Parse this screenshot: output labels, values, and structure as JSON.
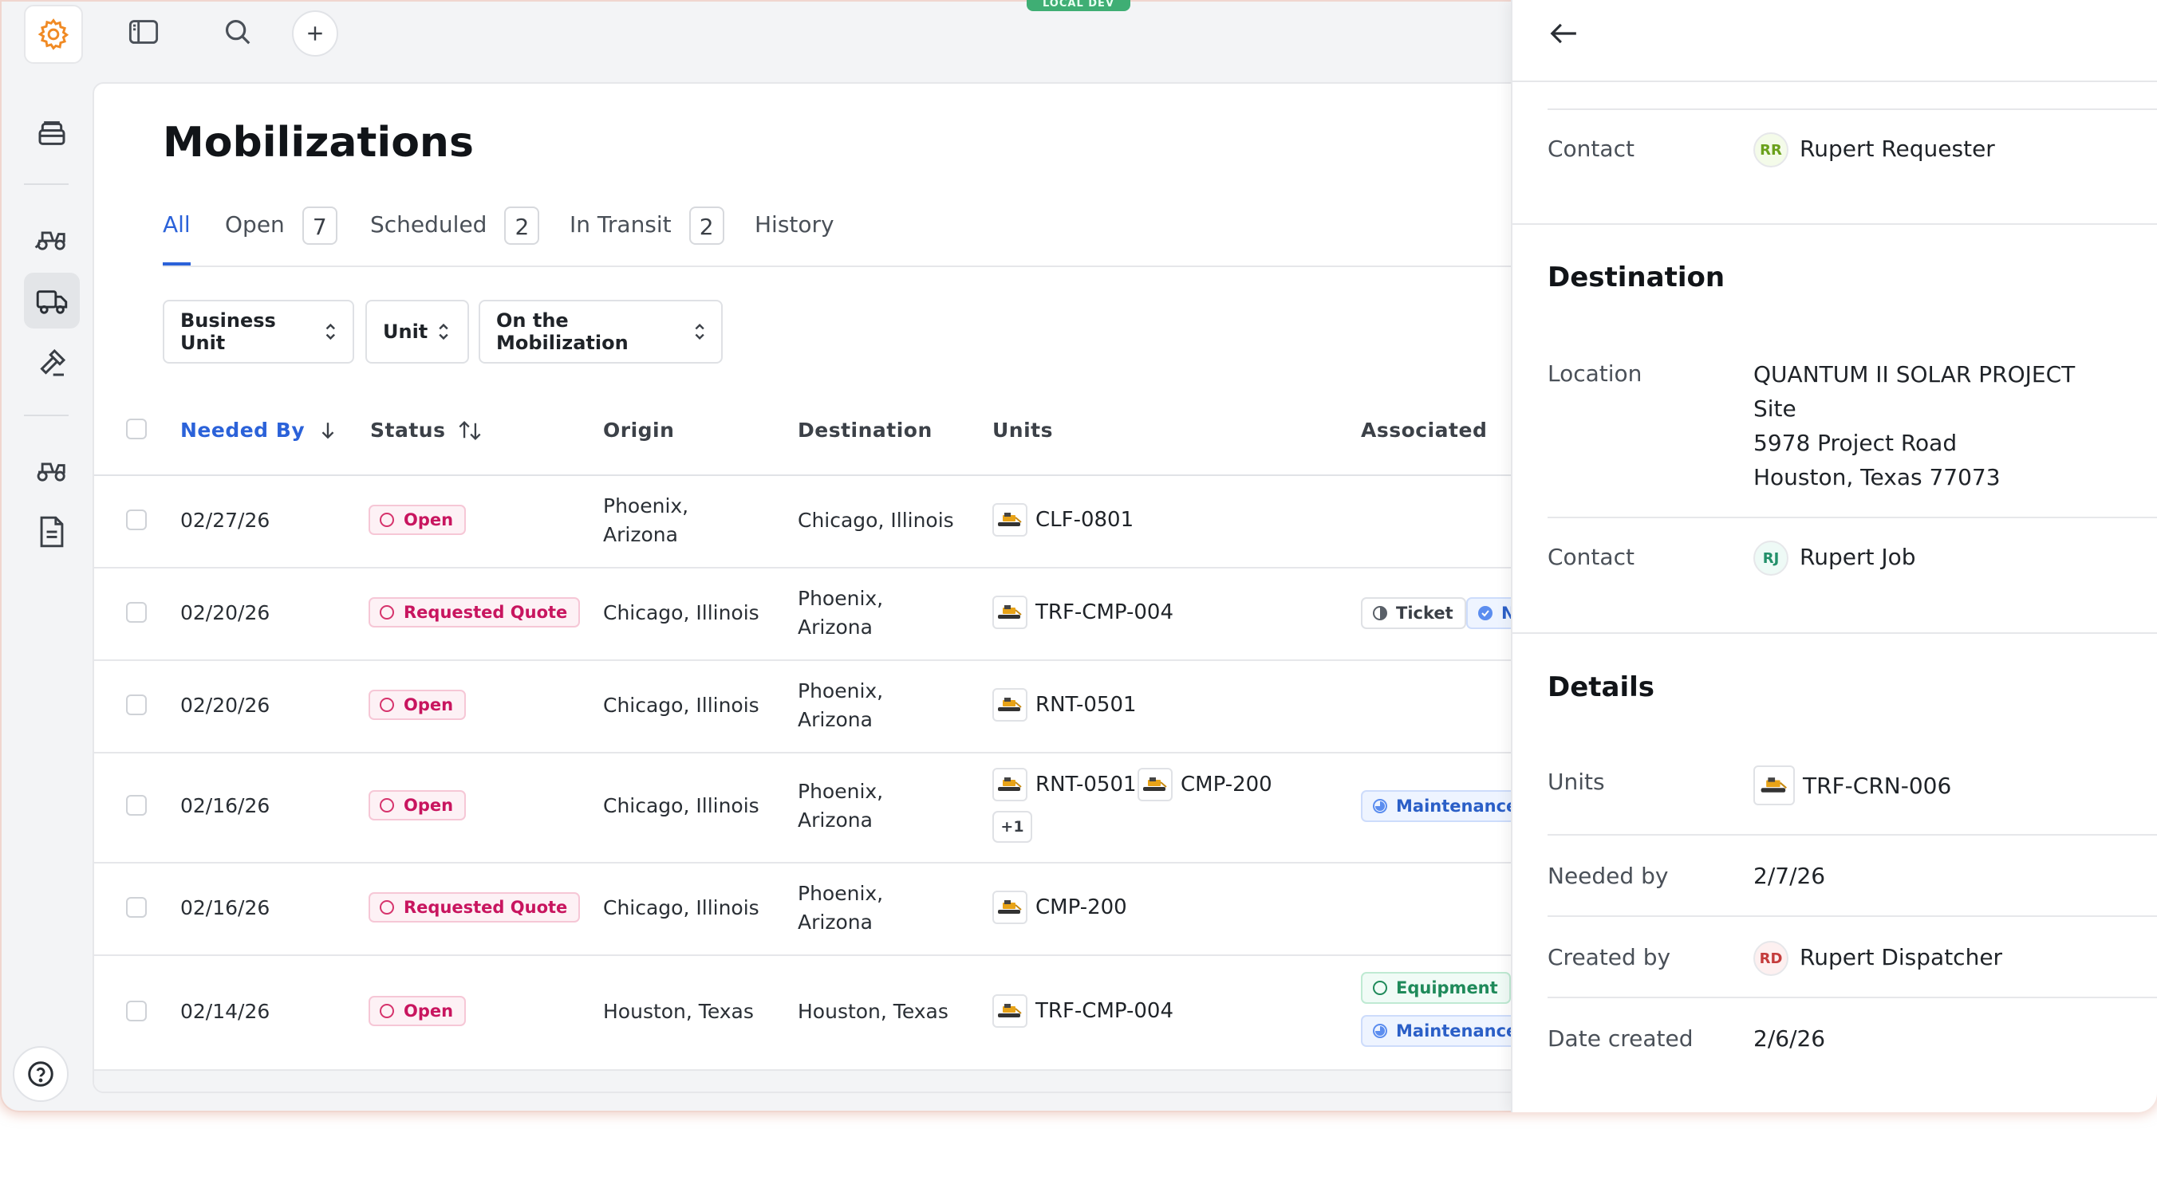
{
  "dev_tag": "LOCAL DEV",
  "page_title": "Mobilizations",
  "tabs": [
    {
      "label": "All",
      "count": null,
      "active": true
    },
    {
      "label": "Open",
      "count": "7"
    },
    {
      "label": "Scheduled",
      "count": "2"
    },
    {
      "label": "In Transit",
      "count": "2"
    },
    {
      "label": "History",
      "count": null
    }
  ],
  "filters": {
    "business_unit": "Business Unit",
    "unit": "Unit",
    "on_mobilization": "On the Mobilization"
  },
  "columns": {
    "needed_by": "Needed By",
    "status": "Status",
    "origin": "Origin",
    "destination": "Destination",
    "units": "Units",
    "associated": "Associated"
  },
  "rows": [
    {
      "needed_by": "02/27/26",
      "status": "Open",
      "origin": [
        "Phoenix,",
        "Arizona"
      ],
      "destination": [
        "Chicago, Illinois"
      ],
      "units": [
        "CLF-0801"
      ],
      "more": "",
      "associated": []
    },
    {
      "needed_by": "02/20/26",
      "status": "Requested Quote",
      "origin": [
        "Chicago, Illinois"
      ],
      "destination": [
        "Phoenix,",
        "Arizona"
      ],
      "units": [
        "TRF-CMP-004"
      ],
      "more": "",
      "associated": [
        "Ticket",
        "N"
      ]
    },
    {
      "needed_by": "02/20/26",
      "status": "Open",
      "origin": [
        "Chicago, Illinois"
      ],
      "destination": [
        "Phoenix,",
        "Arizona"
      ],
      "units": [
        "RNT-0501"
      ],
      "more": "",
      "associated": []
    },
    {
      "needed_by": "02/16/26",
      "status": "Open",
      "origin": [
        "Chicago, Illinois"
      ],
      "destination": [
        "Phoenix,",
        "Arizona"
      ],
      "units": [
        "RNT-0501",
        "CMP-200"
      ],
      "more": "+1",
      "associated": [
        "Maintenance"
      ]
    },
    {
      "needed_by": "02/16/26",
      "status": "Requested Quote",
      "origin": [
        "Chicago, Illinois"
      ],
      "destination": [
        "Phoenix,",
        "Arizona"
      ],
      "units": [
        "CMP-200"
      ],
      "more": "",
      "associated": []
    },
    {
      "needed_by": "02/14/26",
      "status": "Open",
      "origin": [
        "Houston, Texas"
      ],
      "destination": [
        "Houston, Texas"
      ],
      "units": [
        "TRF-CMP-004"
      ],
      "more": "",
      "associated": [
        "Equipment",
        "Maintenance"
      ]
    }
  ],
  "panel": {
    "origin_contact_label": "Contact",
    "origin_contact_initials": "RR",
    "origin_contact_name": "Rupert Requester",
    "destination_title": "Destination",
    "location_label": "Location",
    "location_lines": [
      "QUANTUM II SOLAR PROJECT",
      "Site",
      "5978 Project Road",
      "Houston, Texas 77073"
    ],
    "dest_contact_label": "Contact",
    "dest_contact_initials": "RJ",
    "dest_contact_name": "Rupert Job",
    "details_title": "Details",
    "units_label": "Units",
    "unit_value": "TRF-CRN-006",
    "needed_by_label": "Needed by",
    "needed_by_value": "2/7/26",
    "created_by_label": "Created by",
    "created_by_initials": "RD",
    "created_by_name": "Rupert Dispatcher",
    "date_created_label": "Date created",
    "date_created_value": "2/6/26"
  },
  "colors": {
    "accent": "#2b62d9",
    "status_pink": "#c8155f",
    "badge_blue": "#2b5fc7",
    "badge_green": "#1f8a5a"
  }
}
